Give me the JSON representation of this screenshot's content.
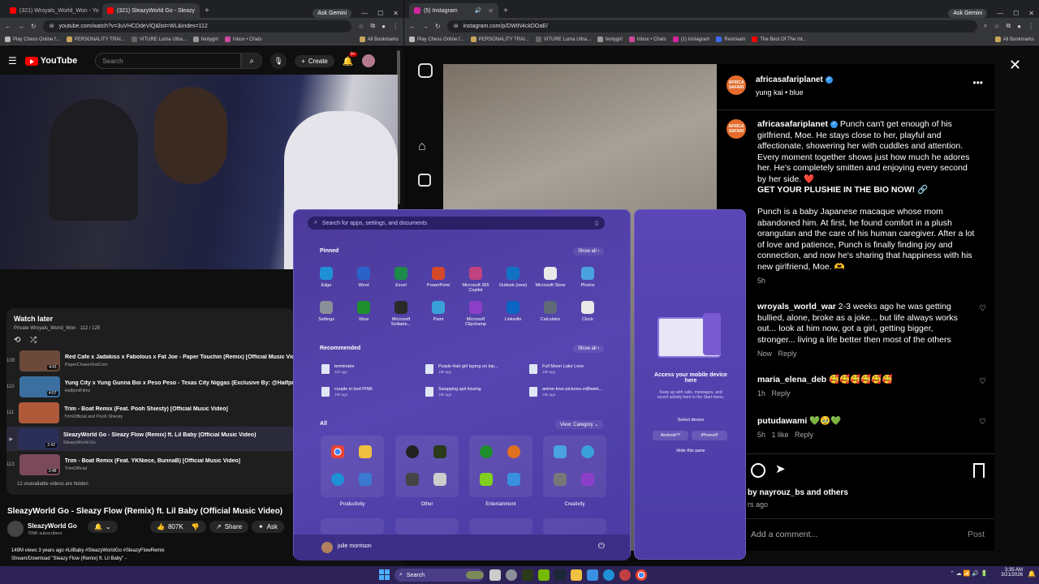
{
  "left_browser": {
    "tabs": [
      {
        "label": "(321) Wroyals_World_Won - Yo",
        "active": false
      },
      {
        "label": "(321) SleazyWorld Go - Sleazy",
        "active": true
      }
    ],
    "ask_gemini": "Ask Gemini",
    "url": "youtube.com/watch?v=3uVHCDdeViQ&list=WL&index=112",
    "bookmarks": [
      "Play Chess Online f...",
      "PERSONALITY TRAI...",
      "VITURE Luma Ultra...",
      "fentygirl",
      "Inbox • Chats"
    ],
    "all_bookmarks": "All Bookmarks"
  },
  "youtube": {
    "logo": "YouTube",
    "search_placeholder": "Search",
    "create": "Create",
    "notif_count": "9+",
    "watch_later": {
      "title": "Watch later",
      "meta": "Private Wroyals_World_Won · 112 / 125",
      "items": [
        {
          "num": "109",
          "title": "Red Cafe x Jadakiss x Fabolous x Fat Joe - Paper Touchin (Remix) [Official Music Video]",
          "channel": "PaperChaserDotCom",
          "dur": "4:41"
        },
        {
          "num": "110",
          "title": "Yung City x Yung Gunna Boi x Peso Peso - Texas City Niggas (Exclusive By: @HalfpintFilmz)",
          "channel": "HalfpintFilmz",
          "dur": "4:07"
        },
        {
          "num": "111",
          "title": "Trim - Boat Remix (Feat. Pooh Shiesty) [Official Music Video]",
          "channel": "TrimOfficial and Pooh Shiesty",
          "dur": ""
        },
        {
          "num": "▶",
          "title": "SleazyWorld Go - Sleazy Flow (Remix) ft. Lil Baby (Official Music Video)",
          "channel": "SleazyWorld Go",
          "dur": "2:42"
        },
        {
          "num": "113",
          "title": "Trim - Boat Remix (Feat. YKNiece, BunnaB) [Official Music Video]",
          "channel": "TrimOfficial",
          "dur": "2:48"
        }
      ],
      "unavailable": "12 unavailable videos are hidden"
    },
    "video_title": "SleazyWorld Go - Sleazy Flow (Remix) ft. Lil Baby (Official Music Video)",
    "channel": "SleazyWorld Go",
    "subs": "709K subscribers",
    "likes": "807K",
    "share": "Share",
    "ask": "Ask",
    "views": "149M views  3 years ago  #LilBaby #SleazyWorldGo #SleazyFlowRemix",
    "desc": "Stream/Download \"Sleazy Flow (Remix) ft. Lil Baby\" -"
  },
  "right_browser": {
    "tab": "(5) Instagram",
    "ask_gemini": "Ask Gemini",
    "url": "instagram.com/p/DWIN4ckDOaE/",
    "bookmarks": [
      "Play Chess Online f...",
      "PERSONALITY TRAI...",
      "VITURE Luma Ultra...",
      "fentygirl",
      "Inbox • Chats",
      "(1) Instagram",
      "Restream",
      "The Best Of The Int..."
    ],
    "all_bookmarks": "All Bookmarks"
  },
  "instagram": {
    "username": "africasafariplanet",
    "audio": "yung kai • blue",
    "caption": "Punch can't get enough of his girlfriend, Moe. He stays close to her, playful and affectionate, showering her with cuddles and attention. Every moment together shows just how much he adores her. He's completely smitten and enjoying every second by her side. ❤️",
    "caption_bold": "GET YOUR PLUSHIE IN THE BIO NOW! 🔗",
    "caption2": "Punch is a baby Japanese macaque whose mom abandoned him. At first, he found comfort in a plush orangutan and the care of his human caregiver. After a lot of love and patience, Punch is finally finding joy and connection, and now he's sharing that happiness with his new girlfriend, Moe. 🫶",
    "caption_time": "5h",
    "comments": [
      {
        "user": "wroyals_world_war",
        "text": "2-3 weeks ago he was getting bullied, alone, broke as a joke... but life always works out... look at him now, got a girl, getting bigger, stronger... living a life better then most of the others",
        "meta": "Now   Reply"
      },
      {
        "user": "maria_elena_deb",
        "text": "🥰🥰🥰🥰🥰🥰",
        "meta": "1h   Reply"
      },
      {
        "user": "putudawami",
        "text": "💚🥹💚",
        "meta": "5h   1 like   Reply"
      }
    ],
    "liked_by": "by nayrouz_bs and others",
    "ago": "rs ago",
    "add_comment": "Add a comment...",
    "post": "Post"
  },
  "start_menu": {
    "search_placeholder": "Search for apps, settings, and documents",
    "pinned": "Pinned",
    "show_all": "Show all",
    "pinned_apps": [
      {
        "name": "Edge",
        "color": "#1e90d6"
      },
      {
        "name": "Word",
        "color": "#2b62c9"
      },
      {
        "name": "Excel",
        "color": "#1d8a4a"
      },
      {
        "name": "PowerPoint",
        "color": "#d5482a"
      },
      {
        "name": "Microsoft 365 Copilot",
        "color": "#c0427e"
      },
      {
        "name": "Outlook (new)",
        "color": "#1172c4"
      },
      {
        "name": "Microsoft Store",
        "color": "#e9e9e9"
      },
      {
        "name": "Photos",
        "color": "#4aa3e0"
      },
      {
        "name": "Settings",
        "color": "#8a8f9a"
      },
      {
        "name": "Xbox",
        "color": "#1f8f2e"
      },
      {
        "name": "Microsoft Solitaire...",
        "color": "#2a2a2a"
      },
      {
        "name": "Paint",
        "color": "#3aa0d8"
      },
      {
        "name": "Microsoft Clipchamp",
        "color": "#8b3fc8"
      },
      {
        "name": "LinkedIn",
        "color": "#0a66c2"
      },
      {
        "name": "Calculator",
        "color": "#5f6a78"
      },
      {
        "name": "Clock",
        "color": "#e9e9e9"
      }
    ],
    "recommended": "Recommended",
    "recommended_items": [
      {
        "name": "terminator",
        "time": "11h ago"
      },
      {
        "name": "Purple Hair girl laying on top...",
        "time": "19h ago"
      },
      {
        "name": "Full Moon Lake Love",
        "time": "19h ago"
      },
      {
        "name": "couple in bed PINK",
        "time": "19h ago"
      },
      {
        "name": "Swapping spit kissing",
        "time": "19h ago"
      },
      {
        "name": "anime-love-pictures-zd8wiek...",
        "time": "19h ago"
      }
    ],
    "all": "All",
    "view_category": "View: Category",
    "categories": [
      "Productivity",
      "Other",
      "Entertainment",
      "Creativity"
    ],
    "user": "julie morrison",
    "phone_panel": {
      "title": "Access your mobile device here",
      "desc": "Keep up with calls, messages, and recent activity here in the Start menu.",
      "select": "Select device",
      "android": "Android™",
      "iphone": "iPhone®",
      "hide": "Hide this pane"
    }
  },
  "taskbar": {
    "search": "Search",
    "time": "3:35 AM",
    "date": "3/21/2026"
  }
}
